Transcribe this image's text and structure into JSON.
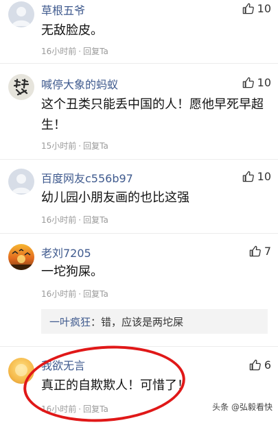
{
  "comments": [
    {
      "username": "草根五爷",
      "text": "无敌脸皮。",
      "time": "16小时前",
      "reply": "回复Ta",
      "likes": "10",
      "avatar": "default-gray-avatar"
    },
    {
      "username": "喊停大象的蚂蚁",
      "text": "这个丑类只能丢中国的人！愿他早死早超生！",
      "time": "15小时前",
      "reply": "回复Ta",
      "likes": "10",
      "avatar": "calligraphy-avatar"
    },
    {
      "username": "百度网友c556b97",
      "text": "幼儿园小朋友画的也比这强",
      "time": "16小时前",
      "reply": "回复Ta",
      "likes": "10",
      "avatar": "default-gray-avatar"
    },
    {
      "username": "老刘7205",
      "text": "一坨狗屎。",
      "time": "16小时前",
      "reply": "回复Ta",
      "likes": "7",
      "avatar": "sunset-birds-avatar",
      "sub_reply": {
        "user": "一叶疯狂",
        "text": "：错，应该是两坨屎"
      }
    },
    {
      "username": "我欲无言",
      "text": "真正的自欺欺人！可惜了！",
      "time": "16小时前",
      "reply": "回复Ta",
      "likes": "6",
      "avatar": "yellow-avatar"
    }
  ],
  "watermark": "头条 @弘毅看快",
  "colors": {
    "username": "#3f5a8e",
    "annotation_circle": "#e01818"
  }
}
